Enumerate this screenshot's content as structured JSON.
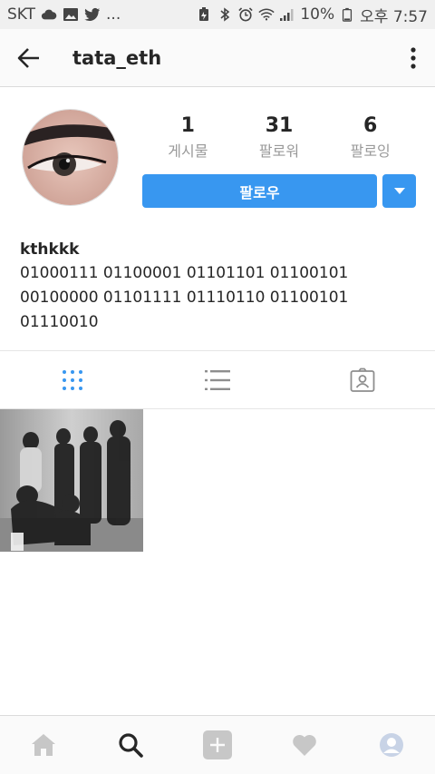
{
  "status_bar": {
    "carrier": "SKT",
    "dots": "...",
    "battery": "10%",
    "time": "오후 7:57"
  },
  "app_bar": {
    "username": "tata_eth"
  },
  "profile": {
    "stats": [
      {
        "value": "1",
        "label": "게시물"
      },
      {
        "value": "31",
        "label": "팔로워"
      },
      {
        "value": "6",
        "label": "팔로잉"
      }
    ],
    "follow_label": "팔로우",
    "name": "kthkkk",
    "bio_lines": [
      "01000111 01100001 01101101 01100101",
      "00100000 01101111 01110110 01100101",
      "01110010"
    ]
  },
  "colors": {
    "accent": "#3897f0",
    "text": "#262626",
    "muted": "#999999"
  },
  "icons": {
    "tabs": [
      "grid-icon",
      "list-icon",
      "tagged-icon"
    ],
    "nav": [
      "home-icon",
      "search-icon",
      "add-icon",
      "heart-icon",
      "profile-icon"
    ]
  }
}
